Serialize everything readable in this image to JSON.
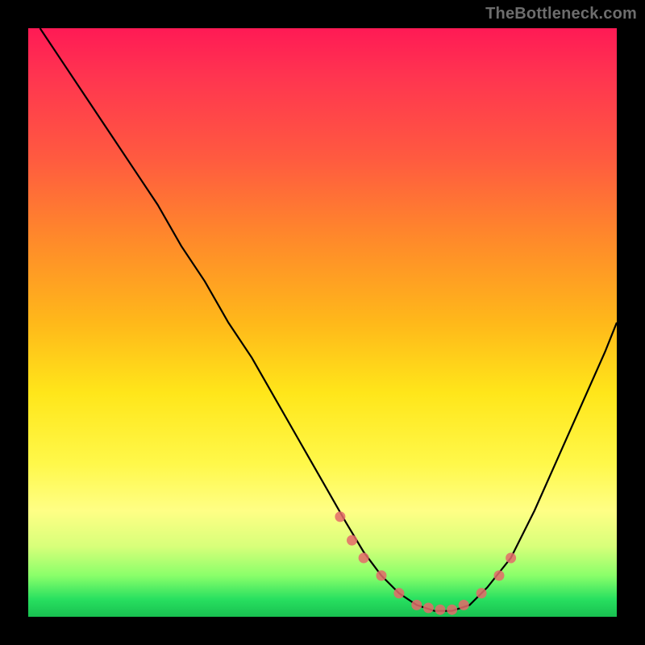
{
  "watermark": "TheBottleneck.com",
  "chart_data": {
    "type": "line",
    "title": "",
    "xlabel": "",
    "ylabel": "",
    "xlim": [
      0,
      100
    ],
    "ylim": [
      0,
      100
    ],
    "series": [
      {
        "name": "bottleneck-curve",
        "x": [
          2,
          6,
          10,
          14,
          18,
          22,
          26,
          30,
          34,
          38,
          42,
          46,
          50,
          54,
          57,
          60,
          63,
          66,
          69,
          72,
          75,
          78,
          82,
          86,
          90,
          94,
          98,
          100
        ],
        "y": [
          100,
          94,
          88,
          82,
          76,
          70,
          63,
          57,
          50,
          44,
          37,
          30,
          23,
          16,
          11,
          7,
          4,
          2,
          1,
          1,
          2,
          5,
          10,
          18,
          27,
          36,
          45,
          50
        ]
      }
    ],
    "markers": {
      "name": "highlight-dots",
      "x": [
        53,
        55,
        57,
        60,
        63,
        66,
        68,
        70,
        72,
        74,
        77,
        80,
        82
      ],
      "y": [
        17,
        13,
        10,
        7,
        4,
        2,
        1.5,
        1.2,
        1.2,
        2,
        4,
        7,
        10
      ]
    },
    "gradient_meaning": "vertical color scale from red (high bottleneck) at top through yellow to green (balanced) at bottom",
    "legend": null,
    "grid": false
  }
}
